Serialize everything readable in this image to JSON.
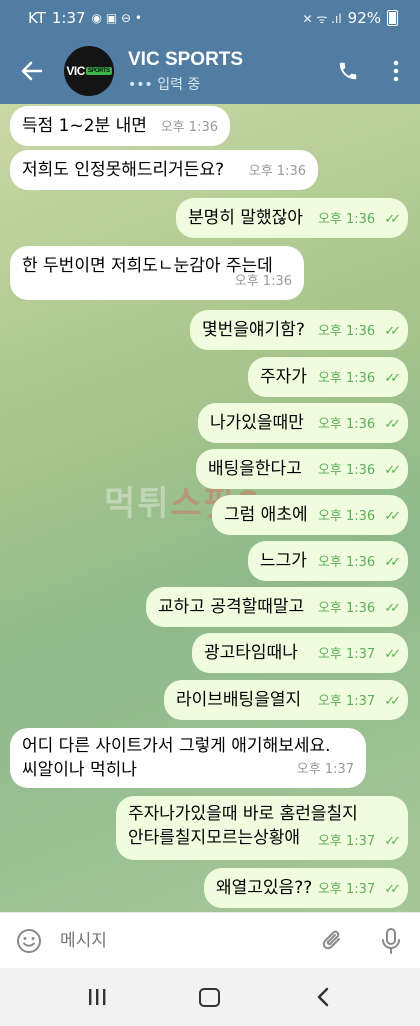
{
  "status_bar": {
    "carrier": "KT",
    "time": "1:37",
    "battery": "92%"
  },
  "header": {
    "chat_title": "VIC SPORTS",
    "chat_status": "••• 입력 중",
    "avatar_text_main": "VIC",
    "avatar_text_badge": "SPORTS"
  },
  "watermark": {
    "part1": "먹튀",
    "part2": "스팟9"
  },
  "messages": [
    {
      "text": "득점 1~2분 내면",
      "time": "오후 1:36"
    },
    {
      "text": "저희도 인정못해드리거든요?",
      "time": "오후 1:36"
    },
    {
      "text": "분명히 말했잖아",
      "time": "오후 1:36"
    },
    {
      "text": "한 두번이면 저희도ㄴ눈감아 주는데",
      "time": "오후 1:36"
    },
    {
      "text": "몇번을얘기함?",
      "time": "오후 1:36"
    },
    {
      "text": "주자가",
      "time": "오후 1:36"
    },
    {
      "text": "나가있을때만",
      "time": "오후 1:36"
    },
    {
      "text": "배팅을한다고",
      "time": "오후 1:36"
    },
    {
      "text": "그럼 애초에",
      "time": "오후 1:36"
    },
    {
      "text": "느그가",
      "time": "오후 1:36"
    },
    {
      "text": "교하고 공격할때말고",
      "time": "오후 1:36"
    },
    {
      "text": "광고타임때나",
      "time": "오후 1:37"
    },
    {
      "text": "라이브배팅을열지",
      "time": "오후 1:37"
    },
    {
      "text": "어디 다른 사이트가서 그렇게 애기해보세요.\n씨알이나 먹히나",
      "time": "오후 1:37"
    },
    {
      "text": "주자나가있을때 바로 홈런을칠지\n안타를칠지모르는상황애",
      "time": "오후 1:37"
    },
    {
      "text": "왜열고있음??",
      "time": "오후 1:37"
    }
  ],
  "input": {
    "placeholder": "메시지"
  },
  "icons": {
    "back": "arrow-left",
    "call": "phone",
    "menu": "more-vertical",
    "emoji": "smile",
    "attach": "paperclip",
    "mic": "microphone",
    "nav_recent": "recent-apps",
    "nav_home": "home",
    "nav_back": "back-chevron"
  },
  "colors": {
    "header": "#517da2",
    "outgoing_bubble": "#effdde",
    "incoming_bubble": "#ffffff",
    "read_check": "#5fae5b"
  }
}
